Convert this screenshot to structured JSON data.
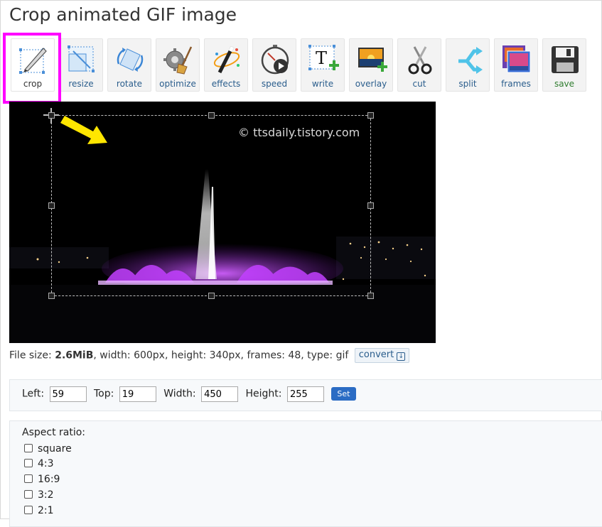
{
  "page": {
    "title": "Crop animated GIF image"
  },
  "toolbar": {
    "tools": [
      {
        "label": "crop",
        "icon": "crop-icon"
      },
      {
        "label": "resize",
        "icon": "resize-icon"
      },
      {
        "label": "rotate",
        "icon": "rotate-icon"
      },
      {
        "label": "optimize",
        "icon": "optimize-icon"
      },
      {
        "label": "effects",
        "icon": "effects-icon"
      },
      {
        "label": "speed",
        "icon": "speed-icon"
      },
      {
        "label": "write",
        "icon": "write-icon"
      },
      {
        "label": "overlay",
        "icon": "overlay-icon"
      },
      {
        "label": "cut",
        "icon": "scissors-icon"
      },
      {
        "label": "split",
        "icon": "split-icon"
      },
      {
        "label": "frames",
        "icon": "frames-icon"
      },
      {
        "label": "save",
        "icon": "floppy-disk-icon"
      }
    ],
    "active": "crop",
    "write_glyph": "T"
  },
  "image": {
    "watermark": "© ttsdaily.tistory.com"
  },
  "fileinfo": {
    "size_label": "File size:",
    "size_value": "2.6MiB",
    "details": ", width: 600px, height: 340px, frames: 48, type: gif",
    "convert_label": "convert"
  },
  "crop_form": {
    "left_label": "Left:",
    "left_value": "59",
    "top_label": "Top:",
    "top_value": "19",
    "width_label": "Width:",
    "width_value": "450",
    "height_label": "Height:",
    "height_value": "255",
    "set_label": "Set"
  },
  "aspect": {
    "title": "Aspect ratio:",
    "options": [
      "square",
      "4:3",
      "16:9",
      "3:2",
      "2:1"
    ]
  },
  "colors": {
    "highlight": "#ff00ff",
    "arrow": "#ffe600",
    "fountain": "#b030ff",
    "set_button": "#2b6cc4"
  }
}
